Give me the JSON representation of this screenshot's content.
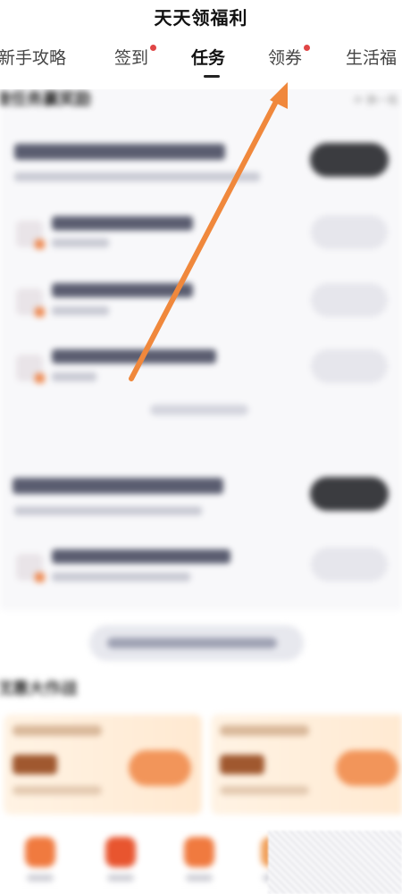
{
  "header": {
    "title": "天天领福利",
    "tabs": [
      {
        "label": "新手攻略",
        "active": false,
        "dot": false
      },
      {
        "label": "签到",
        "active": false,
        "dot": true
      },
      {
        "label": "任务",
        "active": true,
        "dot": false
      },
      {
        "label": "领券",
        "active": false,
        "dot": true
      },
      {
        "label": "生活福",
        "active": false,
        "dot": false
      }
    ]
  },
  "tasks": {
    "section_title": "做任务赢奖励",
    "refresh_label": "换一批"
  },
  "lower": {
    "section_title": "优惠大作战"
  },
  "colors": {
    "accent_orange": "#f08a3c",
    "tab_dot_red": "#e04545",
    "dark_pill": "#3b3c40"
  }
}
